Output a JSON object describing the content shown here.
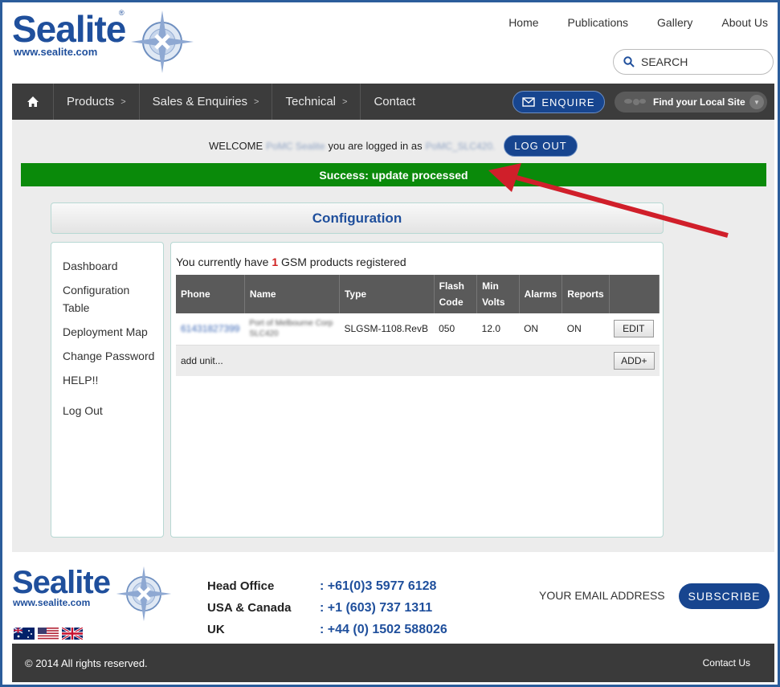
{
  "brand": {
    "name": "Sealite",
    "url": "www.sealite.com",
    "registered_mark": "®"
  },
  "top_nav": [
    "Home",
    "Publications",
    "Gallery",
    "About Us"
  ],
  "search": {
    "placeholder": "SEARCH",
    "icon": "search-icon"
  },
  "main_nav": {
    "home_icon": "home-icon",
    "items": [
      {
        "label": "Products",
        "arrow": ">"
      },
      {
        "label": "Sales & Enquiries",
        "arrow": ">"
      },
      {
        "label": "Technical",
        "arrow": ">"
      },
      {
        "label": "Contact",
        "arrow": ""
      }
    ],
    "enquire_label": "ENQUIRE",
    "find_site_label": "Find your Local Site"
  },
  "session": {
    "welcome_prefix": "WELCOME",
    "user_name": "PoMC Sealite",
    "logged_in_text": "you are logged in as",
    "login_id": "PoMC_SLC420.",
    "logout_label": "LOG OUT"
  },
  "status": {
    "message": "Success: update processed",
    "color": "#0a8a0a"
  },
  "annotation": {
    "arrow_color": "#d01f2a"
  },
  "config": {
    "title": "Configuration",
    "sidebar": [
      "Dashboard",
      "Configuration Table",
      "Deployment Map",
      "Change Password",
      "HELP!!",
      "Log Out"
    ],
    "count_prefix": "You currently have",
    "count": "1",
    "count_suffix": "GSM products registered",
    "table": {
      "headers": [
        "Phone",
        "Name",
        "Type",
        "Flash Code",
        "Min Volts",
        "Alarms",
        "Reports",
        ""
      ],
      "rows": [
        {
          "phone": "61431827399",
          "name": "Port of Melbourne Corp SLC420",
          "type": "SLGSM-1108.RevB",
          "flash_code": "050",
          "min_volts": "12.0",
          "alarms": "ON",
          "reports": "ON",
          "action": "EDIT"
        }
      ],
      "add_text": "add unit...",
      "add_button": "ADD+"
    }
  },
  "footer": {
    "offices": [
      {
        "label": "Head Office",
        "phone": ": +61(0)3 5977 6128"
      },
      {
        "label": "USA & Canada",
        "phone": ": +1 (603) 737 1311"
      },
      {
        "label": "UK",
        "phone": ": +44 (0) 1502 588026"
      }
    ],
    "email_placeholder": "YOUR EMAIL ADDRESS",
    "subscribe_label": "SUBSCRIBE",
    "copyright": "© 2014 All rights reserved.",
    "contact_link": "Contact Us",
    "flags": [
      "australia-flag",
      "usa-flag",
      "uk-flag"
    ]
  }
}
